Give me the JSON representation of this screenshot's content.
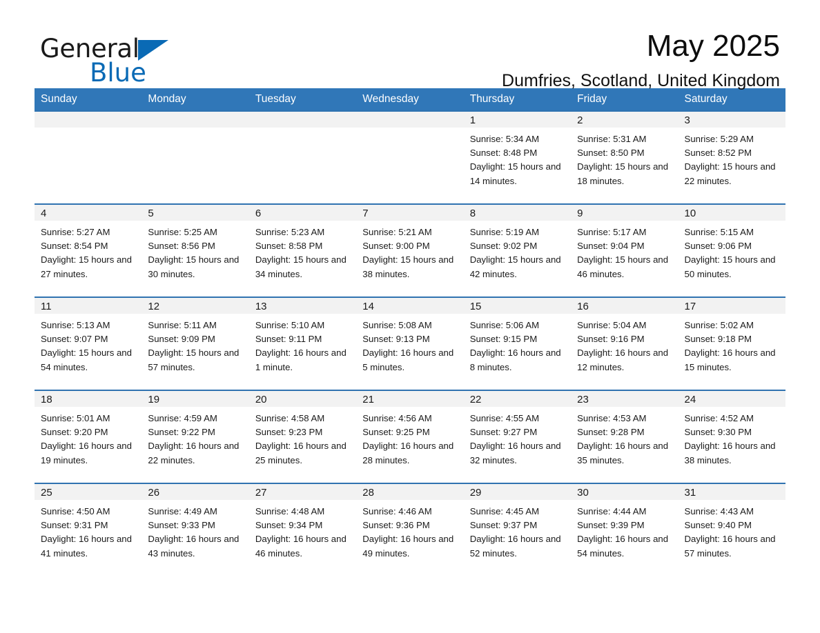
{
  "brand": {
    "word1": "General",
    "word2": "Blue",
    "triangle_color": "#0a6ab5"
  },
  "header": {
    "title": "May 2025",
    "subtitle": "Dumfries, Scotland, United Kingdom"
  },
  "theme": {
    "header_blue": "#3077b8",
    "row_divider_blue": "#2f72b0",
    "daynum_band_gray": "#f2f2f2",
    "text_color": "#1a1a1a"
  },
  "weekdays": [
    "Sunday",
    "Monday",
    "Tuesday",
    "Wednesday",
    "Thursday",
    "Friday",
    "Saturday"
  ],
  "weeks": [
    [
      {
        "day": "",
        "sunrise": "",
        "sunset": "",
        "daylight": ""
      },
      {
        "day": "",
        "sunrise": "",
        "sunset": "",
        "daylight": ""
      },
      {
        "day": "",
        "sunrise": "",
        "sunset": "",
        "daylight": ""
      },
      {
        "day": "",
        "sunrise": "",
        "sunset": "",
        "daylight": ""
      },
      {
        "day": "1",
        "sunrise": "Sunrise: 5:34 AM",
        "sunset": "Sunset: 8:48 PM",
        "daylight": "Daylight: 15 hours and 14 minutes."
      },
      {
        "day": "2",
        "sunrise": "Sunrise: 5:31 AM",
        "sunset": "Sunset: 8:50 PM",
        "daylight": "Daylight: 15 hours and 18 minutes."
      },
      {
        "day": "3",
        "sunrise": "Sunrise: 5:29 AM",
        "sunset": "Sunset: 8:52 PM",
        "daylight": "Daylight: 15 hours and 22 minutes."
      }
    ],
    [
      {
        "day": "4",
        "sunrise": "Sunrise: 5:27 AM",
        "sunset": "Sunset: 8:54 PM",
        "daylight": "Daylight: 15 hours and 27 minutes."
      },
      {
        "day": "5",
        "sunrise": "Sunrise: 5:25 AM",
        "sunset": "Sunset: 8:56 PM",
        "daylight": "Daylight: 15 hours and 30 minutes."
      },
      {
        "day": "6",
        "sunrise": "Sunrise: 5:23 AM",
        "sunset": "Sunset: 8:58 PM",
        "daylight": "Daylight: 15 hours and 34 minutes."
      },
      {
        "day": "7",
        "sunrise": "Sunrise: 5:21 AM",
        "sunset": "Sunset: 9:00 PM",
        "daylight": "Daylight: 15 hours and 38 minutes."
      },
      {
        "day": "8",
        "sunrise": "Sunrise: 5:19 AM",
        "sunset": "Sunset: 9:02 PM",
        "daylight": "Daylight: 15 hours and 42 minutes."
      },
      {
        "day": "9",
        "sunrise": "Sunrise: 5:17 AM",
        "sunset": "Sunset: 9:04 PM",
        "daylight": "Daylight: 15 hours and 46 minutes."
      },
      {
        "day": "10",
        "sunrise": "Sunrise: 5:15 AM",
        "sunset": "Sunset: 9:06 PM",
        "daylight": "Daylight: 15 hours and 50 minutes."
      }
    ],
    [
      {
        "day": "11",
        "sunrise": "Sunrise: 5:13 AM",
        "sunset": "Sunset: 9:07 PM",
        "daylight": "Daylight: 15 hours and 54 minutes."
      },
      {
        "day": "12",
        "sunrise": "Sunrise: 5:11 AM",
        "sunset": "Sunset: 9:09 PM",
        "daylight": "Daylight: 15 hours and 57 minutes."
      },
      {
        "day": "13",
        "sunrise": "Sunrise: 5:10 AM",
        "sunset": "Sunset: 9:11 PM",
        "daylight": "Daylight: 16 hours and 1 minute."
      },
      {
        "day": "14",
        "sunrise": "Sunrise: 5:08 AM",
        "sunset": "Sunset: 9:13 PM",
        "daylight": "Daylight: 16 hours and 5 minutes."
      },
      {
        "day": "15",
        "sunrise": "Sunrise: 5:06 AM",
        "sunset": "Sunset: 9:15 PM",
        "daylight": "Daylight: 16 hours and 8 minutes."
      },
      {
        "day": "16",
        "sunrise": "Sunrise: 5:04 AM",
        "sunset": "Sunset: 9:16 PM",
        "daylight": "Daylight: 16 hours and 12 minutes."
      },
      {
        "day": "17",
        "sunrise": "Sunrise: 5:02 AM",
        "sunset": "Sunset: 9:18 PM",
        "daylight": "Daylight: 16 hours and 15 minutes."
      }
    ],
    [
      {
        "day": "18",
        "sunrise": "Sunrise: 5:01 AM",
        "sunset": "Sunset: 9:20 PM",
        "daylight": "Daylight: 16 hours and 19 minutes."
      },
      {
        "day": "19",
        "sunrise": "Sunrise: 4:59 AM",
        "sunset": "Sunset: 9:22 PM",
        "daylight": "Daylight: 16 hours and 22 minutes."
      },
      {
        "day": "20",
        "sunrise": "Sunrise: 4:58 AM",
        "sunset": "Sunset: 9:23 PM",
        "daylight": "Daylight: 16 hours and 25 minutes."
      },
      {
        "day": "21",
        "sunrise": "Sunrise: 4:56 AM",
        "sunset": "Sunset: 9:25 PM",
        "daylight": "Daylight: 16 hours and 28 minutes."
      },
      {
        "day": "22",
        "sunrise": "Sunrise: 4:55 AM",
        "sunset": "Sunset: 9:27 PM",
        "daylight": "Daylight: 16 hours and 32 minutes."
      },
      {
        "day": "23",
        "sunrise": "Sunrise: 4:53 AM",
        "sunset": "Sunset: 9:28 PM",
        "daylight": "Daylight: 16 hours and 35 minutes."
      },
      {
        "day": "24",
        "sunrise": "Sunrise: 4:52 AM",
        "sunset": "Sunset: 9:30 PM",
        "daylight": "Daylight: 16 hours and 38 minutes."
      }
    ],
    [
      {
        "day": "25",
        "sunrise": "Sunrise: 4:50 AM",
        "sunset": "Sunset: 9:31 PM",
        "daylight": "Daylight: 16 hours and 41 minutes."
      },
      {
        "day": "26",
        "sunrise": "Sunrise: 4:49 AM",
        "sunset": "Sunset: 9:33 PM",
        "daylight": "Daylight: 16 hours and 43 minutes."
      },
      {
        "day": "27",
        "sunrise": "Sunrise: 4:48 AM",
        "sunset": "Sunset: 9:34 PM",
        "daylight": "Daylight: 16 hours and 46 minutes."
      },
      {
        "day": "28",
        "sunrise": "Sunrise: 4:46 AM",
        "sunset": "Sunset: 9:36 PM",
        "daylight": "Daylight: 16 hours and 49 minutes."
      },
      {
        "day": "29",
        "sunrise": "Sunrise: 4:45 AM",
        "sunset": "Sunset: 9:37 PM",
        "daylight": "Daylight: 16 hours and 52 minutes."
      },
      {
        "day": "30",
        "sunrise": "Sunrise: 4:44 AM",
        "sunset": "Sunset: 9:39 PM",
        "daylight": "Daylight: 16 hours and 54 minutes."
      },
      {
        "day": "31",
        "sunrise": "Sunrise: 4:43 AM",
        "sunset": "Sunset: 9:40 PM",
        "daylight": "Daylight: 16 hours and 57 minutes."
      }
    ]
  ]
}
